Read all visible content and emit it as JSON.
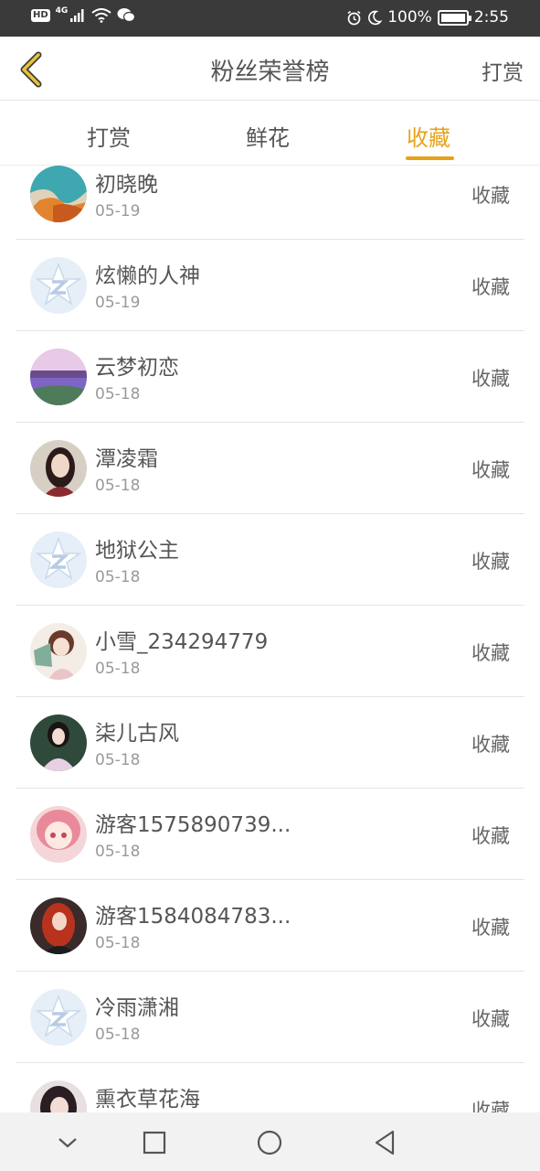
{
  "status_bar": {
    "hd": "HD",
    "network": "4G",
    "battery": "100%",
    "time": "2:55"
  },
  "header": {
    "title": "粉丝荣誉榜",
    "action": "打赏",
    "accent_color": "#e8a21a"
  },
  "tabs": [
    {
      "label": "打赏",
      "active": false
    },
    {
      "label": "鲜花",
      "active": false
    },
    {
      "label": "收藏",
      "active": true
    }
  ],
  "fans": [
    {
      "name": "初晓晚",
      "date": "05-19",
      "action": "收藏",
      "avatar": "beach-photo"
    },
    {
      "name": "炫懒的人神",
      "date": "05-19",
      "action": "收藏",
      "avatar": "default-star-logo"
    },
    {
      "name": "云梦初恋",
      "date": "05-18",
      "action": "收藏",
      "avatar": "lavender-field-photo"
    },
    {
      "name": "潭凌霜",
      "date": "05-18",
      "action": "收藏",
      "avatar": "girl-photo"
    },
    {
      "name": "地狱公主",
      "date": "05-18",
      "action": "收藏",
      "avatar": "default-star-logo"
    },
    {
      "name": "小雪_234294779",
      "date": "05-18",
      "action": "收藏",
      "avatar": "anime-girl-fan"
    },
    {
      "name": "柒儿古风",
      "date": "05-18",
      "action": "收藏",
      "avatar": "girl-in-dress-photo"
    },
    {
      "name": "游客1575890739...",
      "date": "05-18",
      "action": "收藏",
      "avatar": "anime-pink-girl"
    },
    {
      "name": "游客1584084783...",
      "date": "05-18",
      "action": "收藏",
      "avatar": "red-hair-girl"
    },
    {
      "name": "冷雨潇湘",
      "date": "05-18",
      "action": "收藏",
      "avatar": "default-star-logo"
    },
    {
      "name": "熏衣草花海",
      "date": "",
      "action": "收藏",
      "avatar": "dark-hair-girl"
    }
  ],
  "nav": [
    "chevron-down-icon",
    "square-icon",
    "circle-icon",
    "back-triangle-icon"
  ]
}
